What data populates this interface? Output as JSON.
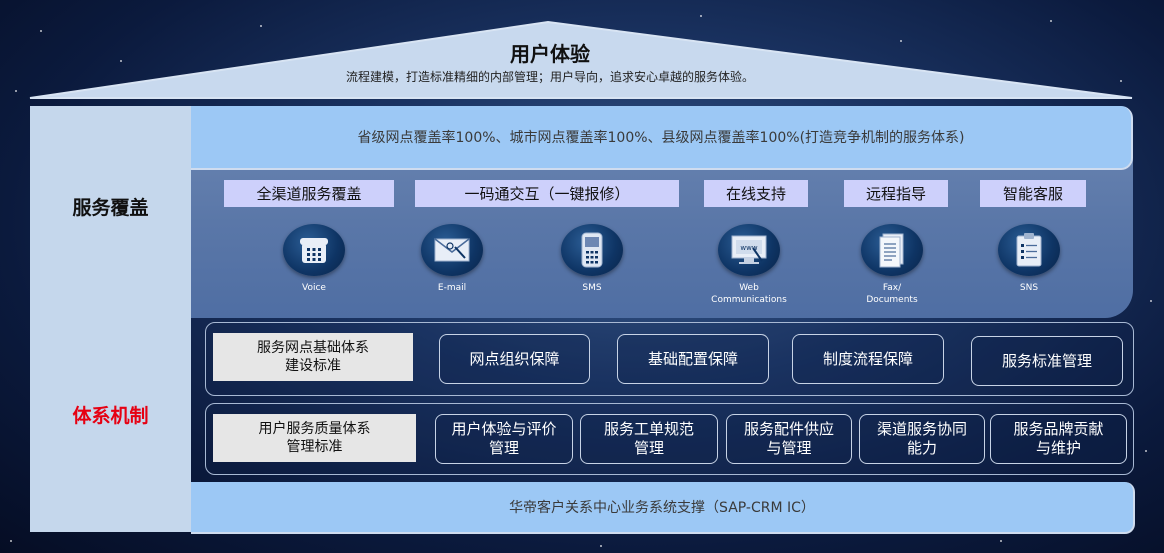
{
  "roof": {
    "title": "用户体验",
    "subtitle": "流程建模，打造标准精细的内部管理；用户导向，追求安心卓越的服务体验。"
  },
  "left": {
    "coverage_label": "服务覆盖",
    "system_label": "体系机制"
  },
  "coverage": {
    "band": "省级网点覆盖率100%、城市网点覆盖率100%、县级网点覆盖率100%(打造竞争机制的服务体系)",
    "chips": [
      "全渠道服务覆盖",
      "一码通交互（一键报修）",
      "在线支持",
      "远程指导",
      "智能客服"
    ],
    "channels": [
      {
        "icon": "telephone-icon",
        "label": "Voice"
      },
      {
        "icon": "envelope-icon",
        "label": "E-mail"
      },
      {
        "icon": "mobile-phone-icon",
        "label": "SMS"
      },
      {
        "icon": "monitor-icon",
        "label": "Web\nCommunications",
        "screen_text": "www"
      },
      {
        "icon": "fax-document-icon",
        "label": "Fax/\nDocuments"
      },
      {
        "icon": "clipboard-icon",
        "label": "SNS"
      }
    ]
  },
  "system": {
    "row1": {
      "standard": "服务网点基础体系\n建设标准",
      "items": [
        "网点组织保障",
        "基础配置保障",
        "制度流程保障",
        "服务标准管理"
      ]
    },
    "row2": {
      "standard": "用户服务质量体系\n管理标准",
      "items": [
        "用户体验与评价\n管理",
        "服务工单规范\n管理",
        "服务配件供应\n与管理",
        "渠道服务协同\n能力",
        "服务品牌贡献\n与维护"
      ]
    }
  },
  "bottom": "华帝客户关系中心业务系统支撑（SAP-CRM IC）",
  "colors": {
    "band": "#9cc8f5",
    "left_column": "#c5d7ec",
    "chip": "#cdd0fb",
    "system_label": "#e60012"
  }
}
